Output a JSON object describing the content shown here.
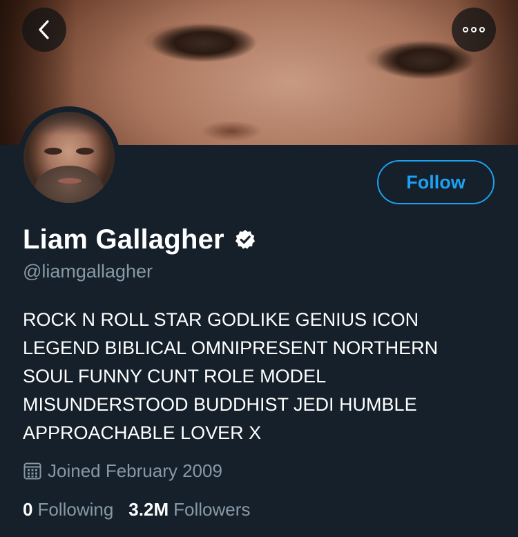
{
  "header": {
    "back_icon": "chevron-left-icon",
    "more_icon": "more-options-icon"
  },
  "profile": {
    "display_name": "Liam Gallagher",
    "verified_icon": "verified-badge-icon",
    "handle": "@liamgallagher",
    "bio_lines": [
      "ROCK N ROLL STAR GODLIKE GENIUS ICON",
      "LEGEND BIBLICAL OMNIPRESENT NORTHERN",
      "SOUL FUNNY CUNT ROLE MODEL",
      "MISUNDERSTOOD BUDDHIST JEDI HUMBLE",
      "APPROACHABLE LOVER X"
    ],
    "joined_icon": "calendar-icon",
    "joined": "Joined February 2009"
  },
  "actions": {
    "follow_label": "Follow"
  },
  "stats": {
    "following_count": "0",
    "following_label": "Following",
    "followers_count": "3.2M",
    "followers_label": "Followers"
  },
  "colors": {
    "background": "#15202b",
    "accent": "#1da1f2",
    "secondary_text": "#8899a6",
    "primary_text": "#ffffff"
  }
}
